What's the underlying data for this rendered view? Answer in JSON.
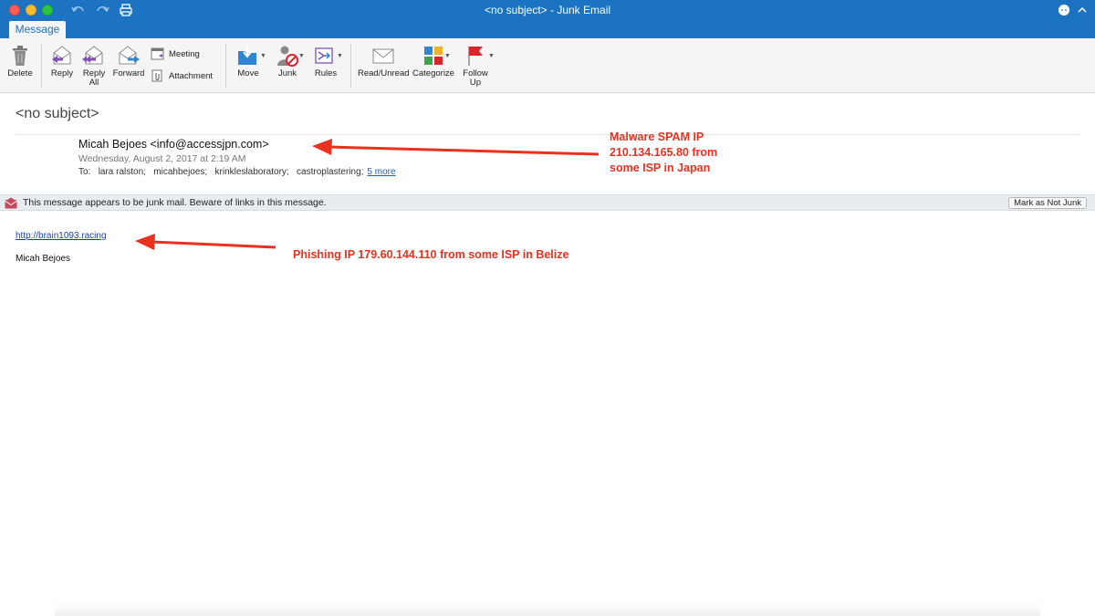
{
  "window": {
    "title": "<no subject> - Junk Email"
  },
  "tabs": {
    "message": "Message"
  },
  "ribbon": {
    "delete": "Delete",
    "reply": "Reply",
    "reply_all_1": "Reply",
    "reply_all_2": "All",
    "forward": "Forward",
    "meeting": "Meeting",
    "attachment": "Attachment",
    "move": "Move",
    "junk": "Junk",
    "rules": "Rules",
    "read_unread": "Read/Unread",
    "categorize": "Categorize",
    "follow_up_1": "Follow",
    "follow_up_2": "Up"
  },
  "message": {
    "subject": "<no subject>",
    "sender": "Micah Bejoes <info@accessjpn.com>",
    "date": "Wednesday, August 2, 2017 at 2:19 AM",
    "to_label": "To:",
    "recipients": [
      "lara ralston;",
      "micahbejoes;",
      "krinkleslaboratory;",
      "castroplastering;"
    ],
    "more": "5 more",
    "link": "http://brain1093.racing",
    "signature": "Micah Bejoes"
  },
  "junk_bar": {
    "text": "This message appears to be junk mail. Beware of links in this message.",
    "button": "Mark as Not Junk"
  },
  "annotations": {
    "spam_1": "Malware SPAM IP",
    "spam_2": "210.134.165.80 from",
    "spam_3": "some ISP in Japan",
    "phishing": "Phishing IP 179.60.144.110 from some ISP in Belize"
  },
  "colors": {
    "brand": "#1b73c2",
    "annotation": "#e8321f",
    "link": "#1a3fb3"
  }
}
